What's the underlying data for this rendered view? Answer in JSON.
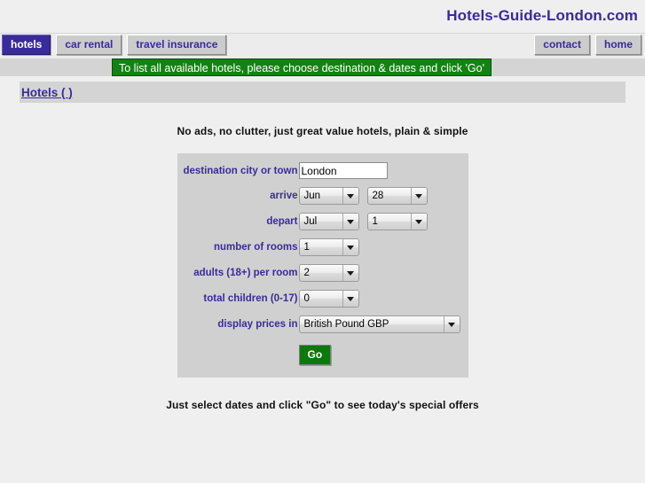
{
  "header": {
    "site_title": "Hotels-Guide-London.com"
  },
  "nav": {
    "left_items": [
      {
        "label": "hotels",
        "active": true
      },
      {
        "label": "car rental",
        "active": false
      },
      {
        "label": "travel insurance",
        "active": false
      }
    ],
    "right_items": [
      {
        "label": "contact"
      },
      {
        "label": "home"
      }
    ]
  },
  "notice": {
    "text": "To list all available hotels, please choose destination & dates and click 'Go'",
    "background_color": "#128312",
    "text_color": "#ffffff"
  },
  "page": {
    "title": "Hotels ( )",
    "tagline": "No ads, no clutter, just great value hotels, plain & simple",
    "footer_note": "Just select dates and click \"Go\" to see today's special offers"
  },
  "form": {
    "destination": {
      "label": "destination city or town",
      "value": "London",
      "placeholder": ""
    },
    "arrive": {
      "label": "arrive",
      "month": "Jun",
      "day": "28"
    },
    "depart": {
      "label": "depart",
      "month": "Jul",
      "day": "1"
    },
    "rooms": {
      "label": "number of rooms",
      "value": "1"
    },
    "adults": {
      "label": "adults (18+) per room",
      "value": "2"
    },
    "children": {
      "label": "total children (0-17)",
      "value": "0"
    },
    "currency": {
      "label": "display prices in",
      "value": "British Pound GBP"
    },
    "submit": {
      "label": "Go",
      "color": "#0a7a0a"
    }
  },
  "theme": {
    "accent_purple": "#3a2b9b",
    "page_background": "#efefef",
    "band_gray": "#d4d4d4",
    "panel_gray": "#d0d0d0"
  }
}
